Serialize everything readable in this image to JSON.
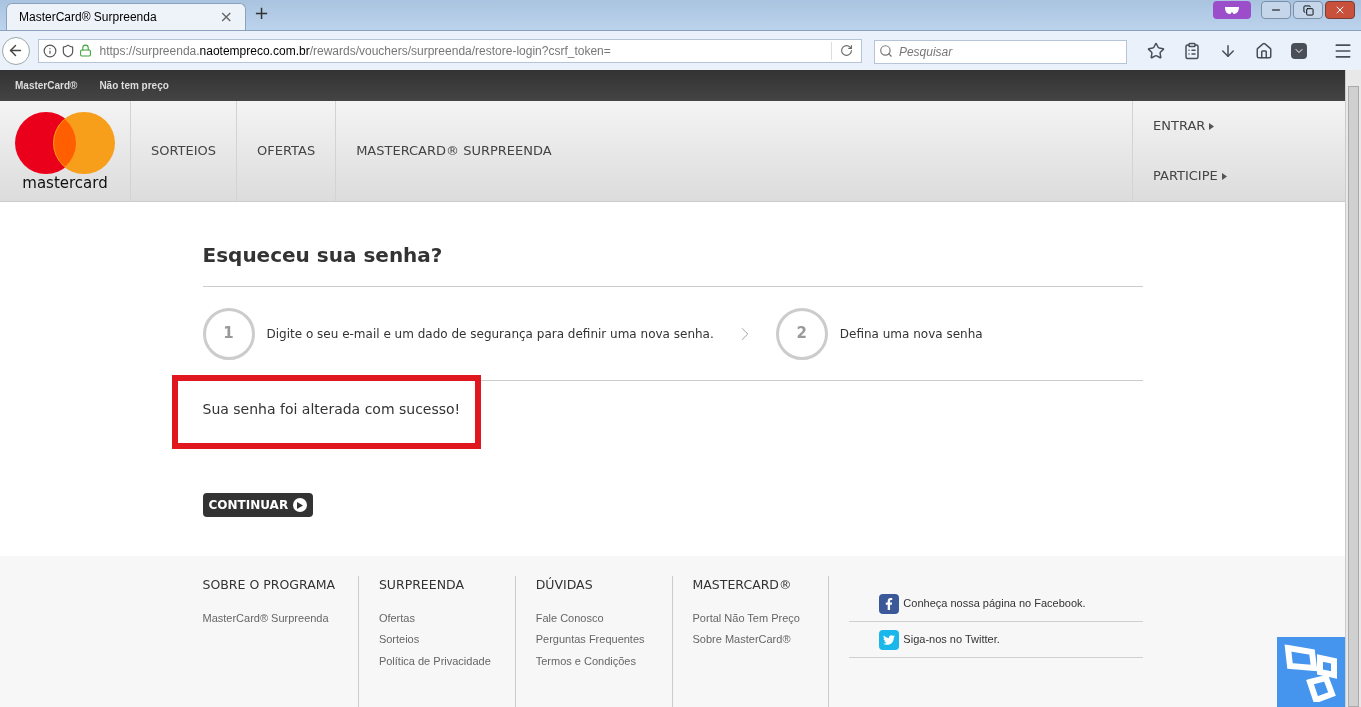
{
  "browser": {
    "tab": {
      "title": "MasterCard® Surpreenda",
      "selected": true
    },
    "close_tab": "×",
    "new_tab": "+",
    "url": {
      "prefix": "https://surpreenda.",
      "domain": "naotempreco.com.br",
      "path": "/rewards/vouchers/surpreenda/restore-login?csrf_token="
    },
    "search": {
      "placeholder": "Pesquisar"
    }
  },
  "top_bar": {
    "links": [
      "MasterCard®",
      "Não tem preço"
    ]
  },
  "header": {
    "logo_text": "mastercard",
    "nav": [
      {
        "label": "SORTEIOS",
        "selected": false
      },
      {
        "label": "OFERTAS",
        "selected": false
      },
      {
        "label": "MASTERCARD® SURPREENDA",
        "selected": false
      }
    ],
    "account": [
      {
        "label": "ENTRAR"
      },
      {
        "label": "PARTICIPE"
      }
    ]
  },
  "main": {
    "title": "Esqueceu sua senha?",
    "steps": [
      {
        "number": "1",
        "text": "Digite o seu e-mail e um dado de segurança para definir uma nova senha."
      },
      {
        "number": "2",
        "text": "Defina uma nova senha"
      }
    ],
    "message": "Sua senha foi alterada com sucesso!",
    "button": "CONTINUAR"
  },
  "footer": {
    "columns": [
      {
        "heading": "SOBRE O PROGRAMA",
        "links": [
          "MasterCard® Surpreenda"
        ]
      },
      {
        "heading": "SURPREENDA",
        "links": [
          "Ofertas",
          "Sorteios",
          "Política de Privacidade"
        ]
      },
      {
        "heading": "DÚVIDAS",
        "links": [
          "Fale Conosco",
          "Perguntas Frequentes",
          "Termos e Condições"
        ]
      },
      {
        "heading": "MASTERCARD®",
        "links": [
          "Portal Não Tem Preço",
          "Sobre MasterCard®"
        ]
      }
    ],
    "social": [
      {
        "kind": "facebook",
        "text": "Conheça nossa página no Facebook."
      },
      {
        "kind": "twitter",
        "text": "Siga-nos no Twitter."
      }
    ]
  }
}
